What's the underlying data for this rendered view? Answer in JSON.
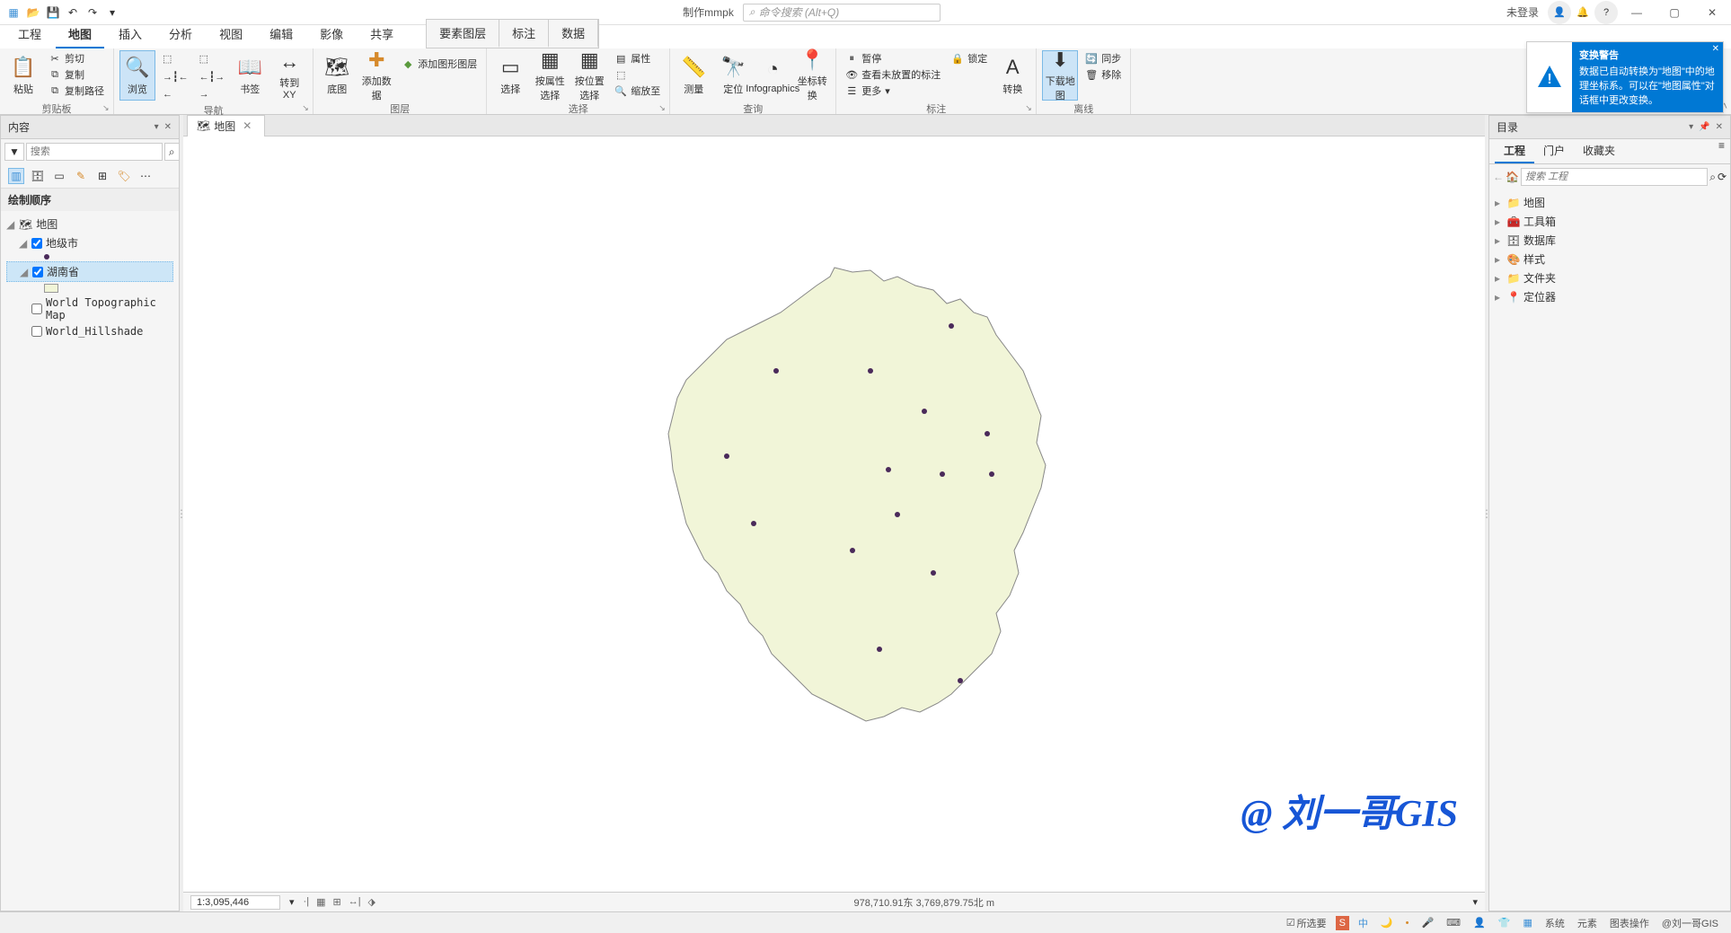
{
  "titlebar": {
    "project": "制作mmpk",
    "search_placeholder": "命令搜索 (Alt+Q)",
    "login": "未登录"
  },
  "ribbon_tabs": {
    "tabs": [
      "工程",
      "地图",
      "插入",
      "分析",
      "视图",
      "编辑",
      "影像",
      "共享"
    ],
    "active": "地图",
    "context_tabs": [
      "要素图层",
      "标注",
      "数据"
    ]
  },
  "ribbon": {
    "clipboard": {
      "paste": "粘贴",
      "cut": "剪切",
      "copy": "复制",
      "copypath": "复制路径",
      "label": "剪贴板"
    },
    "nav": {
      "explore": "浏览",
      "bookmark": "书签",
      "goto": "转到\nXY",
      "label": "导航"
    },
    "layer": {
      "basemap": "底图",
      "adddata": "添加数据",
      "addgraphic": "添加图形图层",
      "label": "图层"
    },
    "selection": {
      "select": "选择",
      "byattr": "按属性选择",
      "byloc": "按位置选择",
      "attributes": "属性",
      "zoomto": "缩放至",
      "clear": "",
      "label": "选择"
    },
    "query": {
      "measure": "测量",
      "locate": "定位",
      "info": "Infographics",
      "coord": "坐标转换",
      "label": "查询"
    },
    "labeling": {
      "pause": "暂停",
      "lock": "锁定",
      "unplaced": "查看未放置的标注",
      "more": "更多",
      "convert": "转换",
      "label": "标注"
    },
    "offline": {
      "download": "下载地图",
      "sync": "同步",
      "remove": "移除",
      "label": "离线"
    }
  },
  "notification": {
    "title": "变换警告",
    "body": "数据已自动转换为\"地图\"中的地理坐标系。可以在\"地图属性\"对话框中更改变换。"
  },
  "contents": {
    "title": "内容",
    "search_placeholder": "搜索",
    "section": "绘制顺序",
    "map": "地图",
    "layers": {
      "cities": "地级市",
      "hunan": "湖南省",
      "topo": "World Topographic Map",
      "hillshade": "World_Hillshade"
    }
  },
  "catalog": {
    "title": "目录",
    "tabs": [
      "工程",
      "门户",
      "收藏夹"
    ],
    "search_placeholder": "搜索 工程",
    "items": [
      "地图",
      "工具箱",
      "数据库",
      "样式",
      "文件夹",
      "定位器"
    ]
  },
  "mapview": {
    "tab": "地图",
    "scale": "1:3,095,446",
    "coords": "978,710.91东 3,769,879.75北 m"
  },
  "taskbar": {
    "selected": "所选要",
    "items": [
      "中",
      "系统",
      "元素",
      "图表操作"
    ],
    "author": "@刘一哥GIS"
  },
  "watermark": "@ 刘一哥GIS"
}
